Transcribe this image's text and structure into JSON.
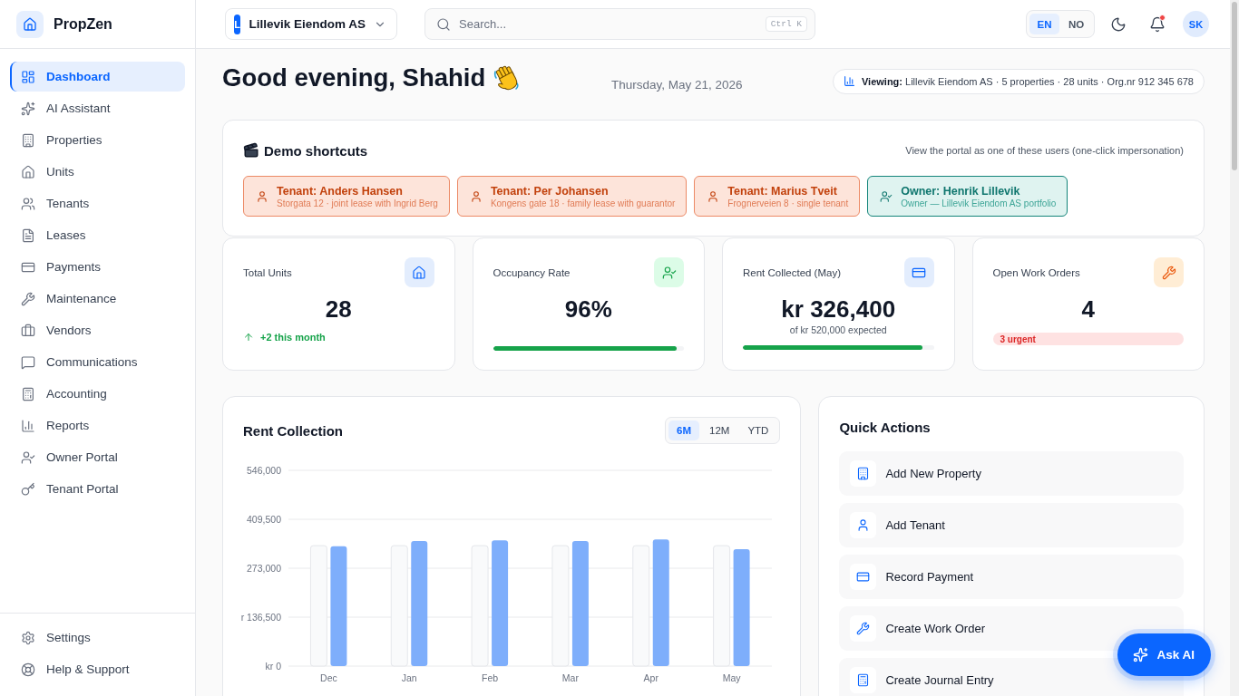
{
  "sidebar": {
    "brand": "PropZen",
    "items": [
      {
        "label": "Dashboard",
        "selected": true
      },
      {
        "label": "AI Assistant",
        "selected": false
      },
      {
        "label": "Properties",
        "selected": false
      },
      {
        "label": "Units",
        "selected": false
      },
      {
        "label": "Tenants",
        "selected": false
      },
      {
        "label": "Leases",
        "selected": false
      },
      {
        "label": "Payments",
        "selected": false
      },
      {
        "label": "Maintenance",
        "selected": false
      },
      {
        "label": "Vendors",
        "selected": false
      },
      {
        "label": "Communications",
        "selected": false
      },
      {
        "label": "Accounting",
        "selected": false
      },
      {
        "label": "Reports",
        "selected": false
      },
      {
        "label": "Owner Portal",
        "selected": false
      },
      {
        "label": "Tenant Portal",
        "selected": false
      }
    ],
    "footer_items": [
      {
        "label": "Settings"
      },
      {
        "label": "Help & Support"
      }
    ]
  },
  "header": {
    "organization": {
      "initial": "L",
      "name": "Lillevik Eiendom AS"
    },
    "search": {
      "placeholder": "Search...",
      "shortcut": "Ctrl K"
    },
    "languages": [
      {
        "label": "EN",
        "selected": true
      },
      {
        "label": "NO",
        "selected": false
      }
    ],
    "notifications_unread": true,
    "avatar": "SK"
  },
  "greeting": {
    "title": "Good evening, Shahid",
    "date": "Thursday, May 21, 2026",
    "viewing": "**Viewing:** Lillevik Eiendom AS · 5 properties · 28 units · Org.nr 912 345 678"
  },
  "demo_shortcuts": {
    "title": "Demo shortcuts",
    "hint": "View the portal as one of these users (one-click impersonation)",
    "items": [
      {
        "kind": "tenant",
        "title": "Tenant: Anders Hansen",
        "subtitle": "Storgata 12 · joint lease with Ingrid Berg"
      },
      {
        "kind": "tenant",
        "title": "Tenant: Per Johansen",
        "subtitle": "Kongens gate 18 · family lease with guarantor"
      },
      {
        "kind": "tenant",
        "title": "Tenant: Marius Tveit",
        "subtitle": "Frognerveien 8 · single tenant"
      },
      {
        "kind": "owner",
        "title": "Owner: Henrik Lillevik",
        "subtitle": "Owner — Lillevik Eiendom AS portfolio"
      }
    ]
  },
  "stats": [
    {
      "kind": "trend",
      "label": "Total Units",
      "value": "28",
      "trend": "+2 this month"
    },
    {
      "kind": "progress",
      "label": "Occupancy Rate",
      "value": "96%",
      "level": 0.96
    },
    {
      "kind": "progress",
      "label": "Rent Collected (May)",
      "value": "kr 326,400",
      "note": "of kr 520,000 expected",
      "level": 0.94
    },
    {
      "kind": "badge",
      "label": "Open Work Orders",
      "value": "4",
      "badge": "3 urgent"
    }
  ],
  "rent_collection": {
    "title": "Rent Collection",
    "ranges": [
      {
        "label": "6M",
        "selected": true
      },
      {
        "label": "12M",
        "selected": false
      },
      {
        "label": "YTD",
        "selected": false
      }
    ],
    "chart_data": {
      "type": "bar",
      "grid": true,
      "categories": [
        "Dec",
        "Jan",
        "Feb",
        "Mar",
        "Apr",
        "May"
      ],
      "series": [
        {
          "color": "#f9fafb",
          "values": [
            336000,
            336000,
            336000,
            336000,
            336000,
            336000
          ]
        },
        {
          "color": "#7eaefb",
          "values": [
            334000,
            349000,
            351000,
            349000,
            353000,
            326000
          ]
        }
      ],
      "ylim": [
        0,
        546000
      ],
      "yticks": [
        {
          "value": 546000,
          "label": "546,000"
        },
        {
          "value": 409500,
          "label": "409,500"
        },
        {
          "value": 273000,
          "label": "273,000"
        },
        {
          "value": 136500,
          "label": "r 136,500"
        },
        {
          "value": 0,
          "label": "kr 0"
        }
      ]
    }
  },
  "quick_actions": {
    "title": "Quick Actions",
    "items": [
      {
        "label": "Add New Property"
      },
      {
        "label": "Add Tenant"
      },
      {
        "label": "Record Payment"
      },
      {
        "label": "Create Work Order"
      },
      {
        "label": "Create Journal Entry"
      }
    ]
  },
  "ask_ai": {
    "label": "Ask AI"
  }
}
